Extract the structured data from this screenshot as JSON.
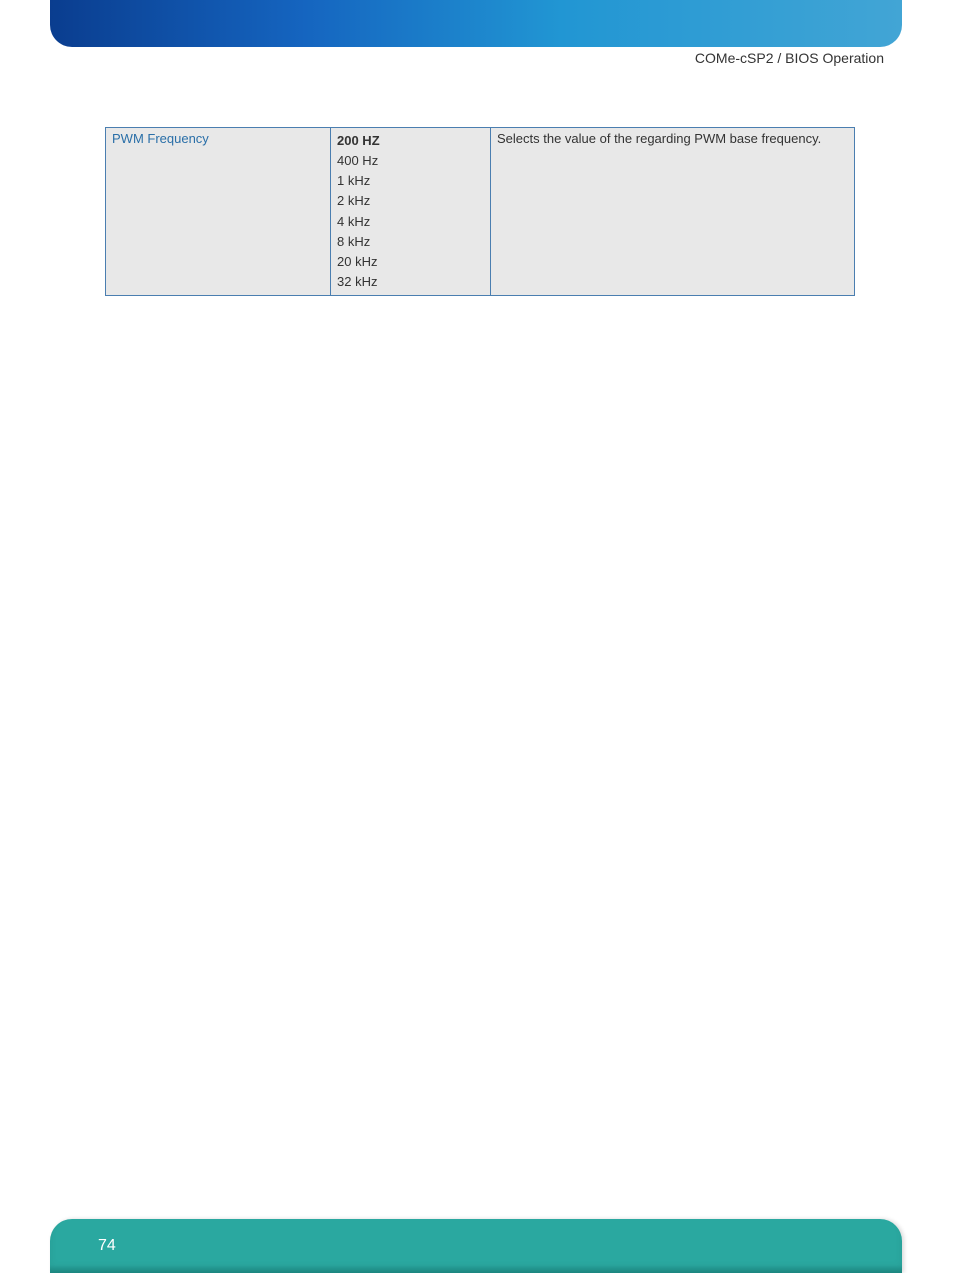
{
  "breadcrumb": "COMe-cSP2 / BIOS Operation",
  "table": {
    "row": {
      "label": "PWM Frequency",
      "values": [
        "200 HZ",
        "400 Hz",
        "1 kHz",
        "2 kHz",
        "4 kHz",
        "8 kHz",
        "20 kHz",
        "32 kHz"
      ],
      "description": "Selects the value of the regarding PWM base frequency."
    }
  },
  "page_number": "74"
}
